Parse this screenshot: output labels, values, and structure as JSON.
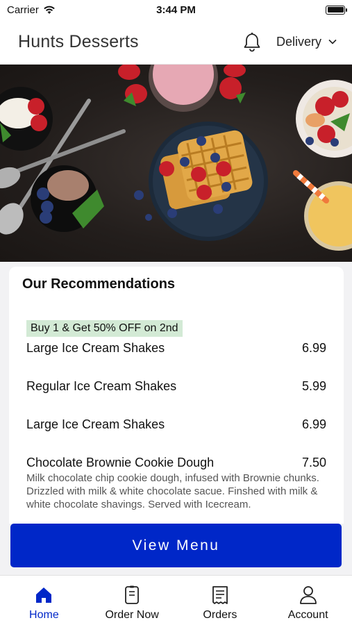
{
  "status_bar": {
    "carrier": "Carrier",
    "time": "3:44 PM"
  },
  "header": {
    "title": "Hunts Desserts",
    "delivery_label": "Delivery"
  },
  "recommendations": {
    "title": "Our Recommendations",
    "promo": "Buy 1 & Get 50% OFF on 2nd",
    "items": [
      {
        "name": "Large Ice Cream Shakes",
        "price": "6.99"
      },
      {
        "name": "Regular Ice Cream Shakes",
        "price": "5.99"
      },
      {
        "name": "Large Ice Cream Shakes",
        "price": "6.99"
      },
      {
        "name": "Chocolate Brownie Cookie Dough",
        "price": "7.50",
        "description": "Milk chocolate chip cookie dough, infused with Brownie chunks. Drizzled with milk & white chocolate sacue. Finshed with milk & white chocolate shavings. Served with Icecream."
      }
    ]
  },
  "view_menu_label": "View Menu",
  "tabs": [
    {
      "label": "Home",
      "icon": "home-icon",
      "active": true
    },
    {
      "label": "Order Now",
      "icon": "order-now-icon",
      "active": false
    },
    {
      "label": "Orders",
      "icon": "orders-icon",
      "active": false
    },
    {
      "label": "Account",
      "icon": "account-icon",
      "active": false
    }
  ],
  "colors": {
    "accent": "#0027c8",
    "promo_bg": "#d3ead5"
  }
}
